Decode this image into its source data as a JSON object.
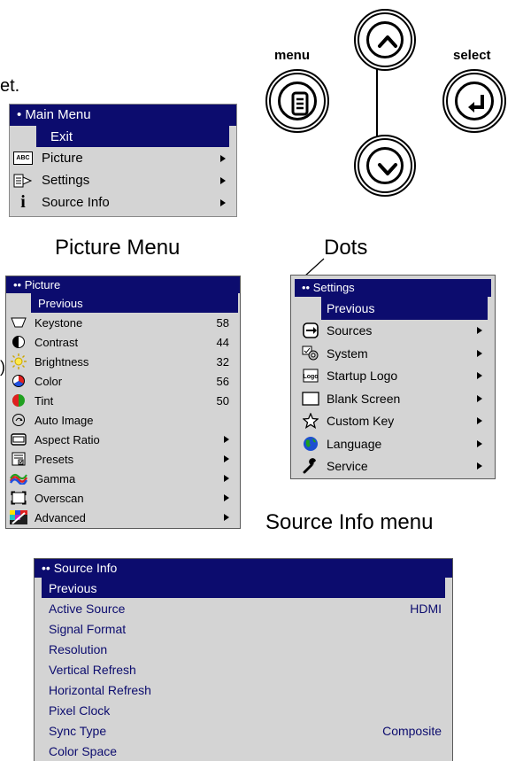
{
  "intro_fragment": "et.",
  "keypad": {
    "menu_label": "menu",
    "select_label": "select"
  },
  "captions": {
    "picture_menu": "Picture Menu",
    "dots": "Dots",
    "source_info_menu": "Source Info menu"
  },
  "main_menu": {
    "title": "• Main Menu",
    "items": [
      {
        "label": "Exit",
        "icon": "none",
        "selected": true
      },
      {
        "label": "Picture",
        "icon": "abc-picture-icon",
        "arrow": true
      },
      {
        "label": "Settings",
        "icon": "settings-icon",
        "arrow": true
      },
      {
        "label": "Source Info",
        "icon": "info-icon",
        "arrow": true
      }
    ]
  },
  "picture_menu": {
    "title": "•• Picture",
    "items": [
      {
        "label": "Previous",
        "selected": true
      },
      {
        "label": "Keystone",
        "icon": "keystone-icon",
        "value": "58"
      },
      {
        "label": "Contrast",
        "icon": "contrast-icon",
        "value": "44"
      },
      {
        "label": "Brightness",
        "icon": "brightness-icon",
        "value": "32"
      },
      {
        "label": "Color",
        "icon": "color-icon",
        "value": "56"
      },
      {
        "label": "Tint",
        "icon": "tint-icon",
        "value": "50"
      },
      {
        "label": "Auto Image",
        "icon": "auto-image-icon"
      },
      {
        "label": "Aspect Ratio",
        "icon": "aspect-ratio-icon",
        "arrow": true
      },
      {
        "label": "Presets",
        "icon": "presets-icon",
        "arrow": true
      },
      {
        "label": "Gamma",
        "icon": "gamma-icon",
        "arrow": true
      },
      {
        "label": "Overscan",
        "icon": "overscan-icon",
        "arrow": true
      },
      {
        "label": "Advanced",
        "icon": "advanced-icon",
        "arrow": true
      }
    ]
  },
  "settings_menu": {
    "title": "•• Settings",
    "items": [
      {
        "label": "Previous",
        "selected": true
      },
      {
        "label": "Sources",
        "icon": "sources-icon",
        "arrow": true
      },
      {
        "label": "System",
        "icon": "system-icon",
        "arrow": true
      },
      {
        "label": "Startup Logo",
        "icon": "logo-icon",
        "arrow": true
      },
      {
        "label": "Blank Screen",
        "icon": "blank-screen-icon",
        "arrow": true
      },
      {
        "label": "Custom Key",
        "icon": "star-icon",
        "arrow": true
      },
      {
        "label": "Language",
        "icon": "globe-icon",
        "arrow": true
      },
      {
        "label": "Service",
        "icon": "wrench-icon",
        "arrow": true
      }
    ]
  },
  "source_info_menu": {
    "title": "•• Source Info",
    "items": [
      {
        "label": "Previous",
        "selected": true
      },
      {
        "label": "Active Source",
        "value": "HDMI"
      },
      {
        "label": "Signal Format"
      },
      {
        "label": "Resolution"
      },
      {
        "label": "Vertical Refresh"
      },
      {
        "label": "Horizontal Refresh"
      },
      {
        "label": "Pixel Clock"
      },
      {
        "label": "Sync Type",
        "value": "Composite"
      },
      {
        "label": "Color Space"
      }
    ]
  },
  "colors": {
    "menu_bg": "#d4d4d4",
    "highlight": "#0c0c6e",
    "info_text": "#0c0c6e"
  }
}
